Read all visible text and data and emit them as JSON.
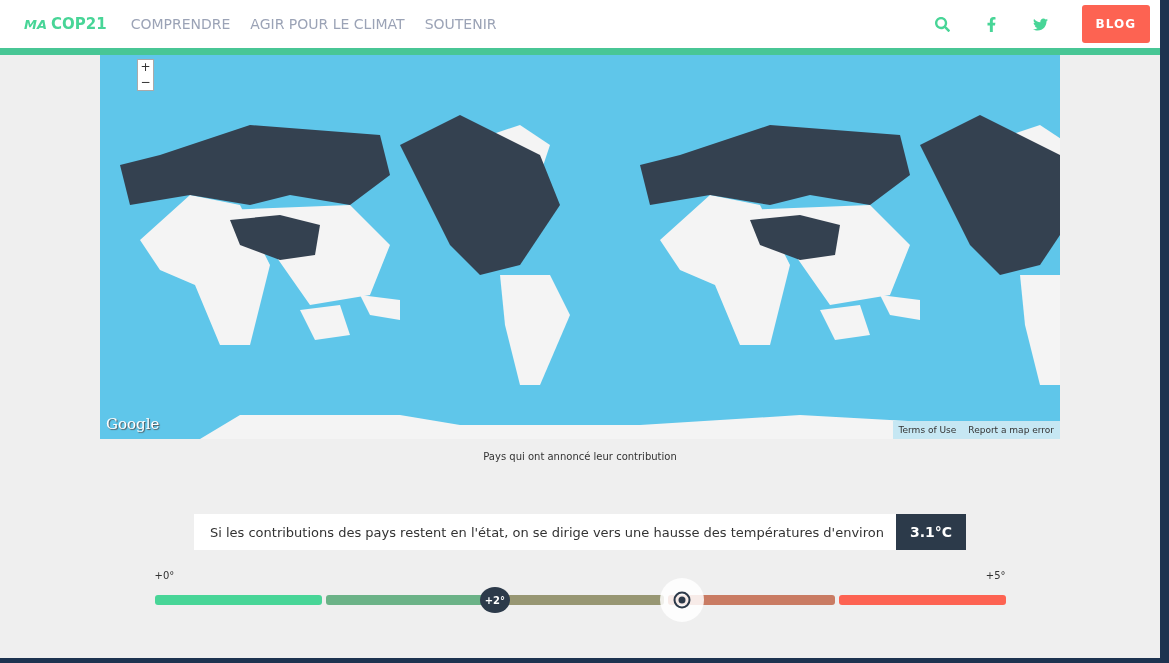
{
  "header": {
    "logo": {
      "prefix": "MA",
      "name": "COP21"
    },
    "nav": [
      {
        "label": "COMPRENDRE"
      },
      {
        "label": "AGIR POUR LE CLIMAT"
      },
      {
        "label": "SOUTENIR"
      }
    ],
    "blog_button": "BLOG"
  },
  "map": {
    "zoom_in": "+",
    "zoom_out": "−",
    "provider_logo": "Google",
    "links": [
      "Terms of Use",
      "Report a map error"
    ],
    "caption": "Pays qui ont annoncé leur contribution"
  },
  "statement": {
    "text": "Si les contributions des pays restent en l'état, on se dirige vers une hausse des températures d'environ",
    "value": "3.1°C"
  },
  "scale": {
    "min_label": "+0°",
    "max_label": "+5°",
    "segments": [
      {
        "color": "#48d597"
      },
      {
        "color": "#6bb287"
      },
      {
        "color": "#979673"
      },
      {
        "color": "#c97b63"
      },
      {
        "color": "#fd6352"
      }
    ],
    "markers": [
      {
        "kind": "target",
        "label": "+2°",
        "level": 0.4
      },
      {
        "kind": "current",
        "level": 0.62
      }
    ]
  }
}
